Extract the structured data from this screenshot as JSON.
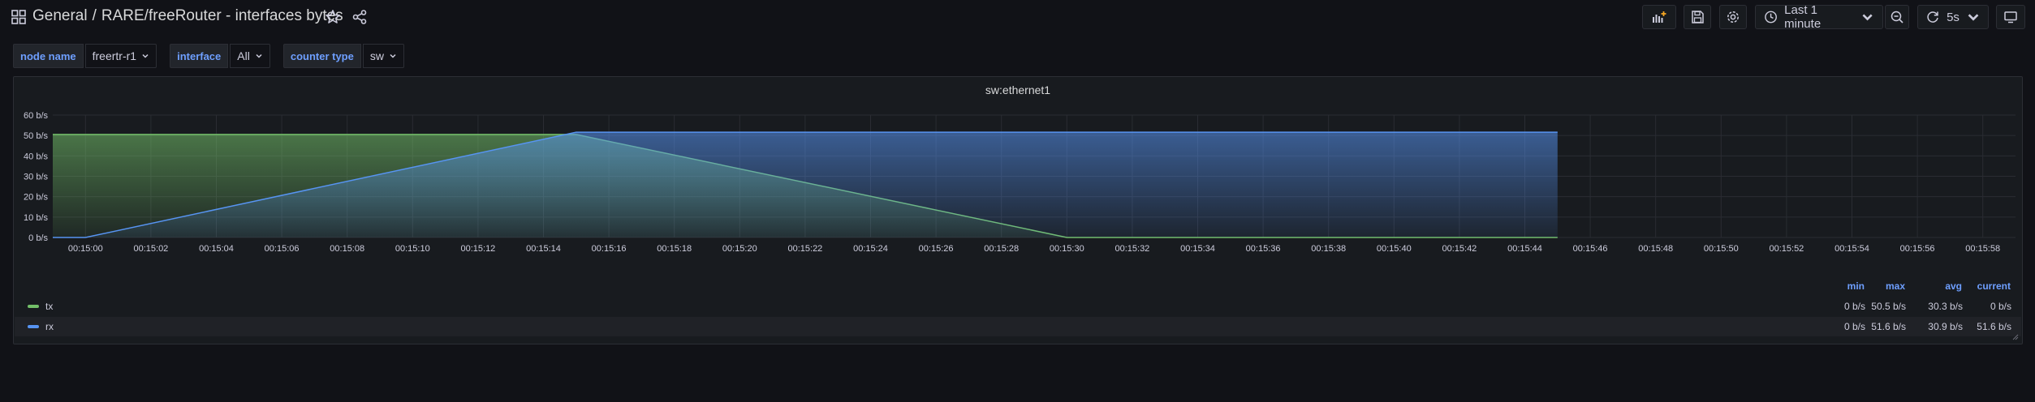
{
  "header": {
    "folder": "General",
    "separator": "/",
    "title": "RARE/freeRouter - interfaces bytes",
    "time_range": "Last 1 minute",
    "refresh": "5s"
  },
  "variables": [
    {
      "label": "node name",
      "value": "freertr-r1"
    },
    {
      "label": "interface",
      "value": "All"
    },
    {
      "label": "counter type",
      "value": "sw"
    }
  ],
  "panel": {
    "title": "sw:ethernet1",
    "legend_columns": [
      "min",
      "max",
      "avg",
      "current"
    ],
    "legend_rows": [
      {
        "name": "tx",
        "color": "#73bf69",
        "min": "0 b/s",
        "max": "50.5 b/s",
        "avg": "30.3 b/s",
        "current": "0 b/s"
      },
      {
        "name": "rx",
        "color": "#5794f2",
        "min": "0 b/s",
        "max": "51.6 b/s",
        "avg": "30.9 b/s",
        "current": "51.6 b/s"
      }
    ]
  },
  "chart_data": {
    "type": "area",
    "title": "sw:ethernet1",
    "xlabel": "",
    "ylabel": "",
    "ylim": [
      0,
      60
    ],
    "yticks": [
      "0 b/s",
      "10 b/s",
      "20 b/s",
      "30 b/s",
      "40 b/s",
      "50 b/s",
      "60 b/s"
    ],
    "xlim": [
      "00:14:59",
      "00:15:59"
    ],
    "xticks": [
      "00:15:00",
      "00:15:02",
      "00:15:04",
      "00:15:06",
      "00:15:08",
      "00:15:10",
      "00:15:12",
      "00:15:14",
      "00:15:16",
      "00:15:18",
      "00:15:20",
      "00:15:22",
      "00:15:24",
      "00:15:26",
      "00:15:28",
      "00:15:30",
      "00:15:32",
      "00:15:34",
      "00:15:36",
      "00:15:38",
      "00:15:40",
      "00:15:42",
      "00:15:44",
      "00:15:46",
      "00:15:48",
      "00:15:50",
      "00:15:52",
      "00:15:54",
      "00:15:56",
      "00:15:58"
    ],
    "grid": true,
    "legend": "bottom",
    "series": [
      {
        "name": "tx",
        "color": "#73bf69",
        "x": [
          "00:14:59",
          "00:15:15",
          "00:15:30",
          "00:15:45"
        ],
        "values": [
          50.5,
          50.5,
          0,
          0
        ]
      },
      {
        "name": "rx",
        "color": "#5794f2",
        "x": [
          "00:14:59",
          "00:15:00",
          "00:15:15",
          "00:15:45"
        ],
        "values": [
          0,
          0,
          51.6,
          51.6
        ]
      }
    ]
  }
}
